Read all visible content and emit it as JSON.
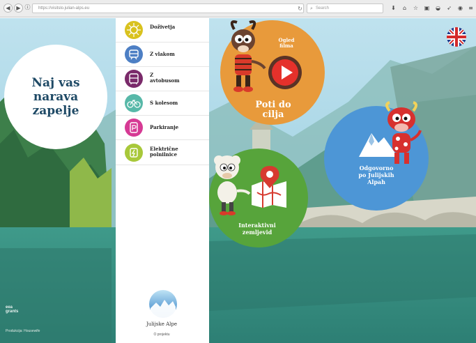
{
  "browser": {
    "url": "https://visitslo.julian-alps.eu",
    "search_placeholder": "Search"
  },
  "page": {
    "title": "Naj vas\nnarava\nzapelje",
    "menu": [
      {
        "label": "Doživetja",
        "icon": "sun-icon",
        "color": "#d9c21e"
      },
      {
        "label": "Z vlakom",
        "icon": "train-icon",
        "color": "#4d7fc4"
      },
      {
        "label": "Z\navtobusom",
        "icon": "bus-icon",
        "color": "#7a2a6a"
      },
      {
        "label": "S kolesom",
        "icon": "bicycle-icon",
        "color": "#57b8a8"
      },
      {
        "label": "Parkiranje",
        "icon": "parking-icon",
        "color": "#d63a94"
      },
      {
        "label": "Električne\npolnilnice",
        "icon": "charging-icon",
        "color": "#a8c83a"
      }
    ],
    "logo_text": "Julijske Alpe",
    "about_link": "O projektu",
    "circles": {
      "orange": {
        "top_label": "Ogled\nfilma",
        "label": "Poti do\ncilja",
        "color": "#e89a3b"
      },
      "blue": {
        "label": "Odgovorno\npo Julijskih\nAlpah",
        "color": "#4d96d6"
      },
      "green": {
        "label": "Interaktivni\nzemljevid",
        "color": "#57a43b"
      }
    },
    "footer": {
      "eea_line1": "eea",
      "eea_line2": "grants",
      "production": "Produkcija: Housewife"
    },
    "language_flag": "uk-flag-icon"
  }
}
